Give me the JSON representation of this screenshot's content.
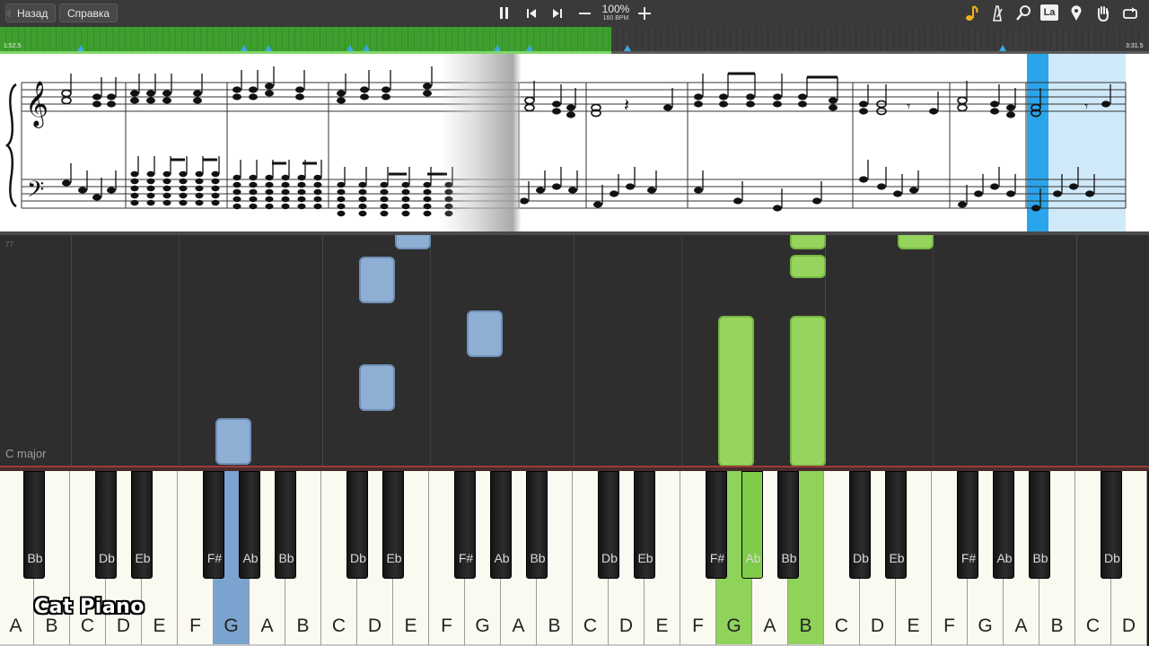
{
  "toolbar": {
    "back_label": "Назад",
    "help_label": "Справка",
    "zoom": "100%",
    "bpm": "160 BPM",
    "icons": [
      "pause-icon",
      "prev-icon",
      "next-icon",
      "minus-icon",
      "plus-icon",
      "note-icon",
      "metronome-icon",
      "search-icon",
      "la-icon",
      "pin-icon",
      "hand-icon",
      "loop-icon"
    ],
    "la_label": "La"
  },
  "timeline": {
    "start_time": "1:52.5",
    "end_time": "3:31.5",
    "progress": 0.53
  },
  "roll": {
    "measure_number": "77",
    "key_label": "C major"
  },
  "keyboard": {
    "white_keys": [
      "A",
      "B",
      "C",
      "D",
      "E",
      "F",
      "G",
      "A",
      "B",
      "C",
      "D",
      "E",
      "F",
      "G",
      "A",
      "B",
      "C",
      "D",
      "E",
      "F",
      "G",
      "A",
      "B",
      "C",
      "D",
      "E",
      "F",
      "G",
      "A",
      "B",
      "C",
      "D"
    ],
    "black_keys": [
      "Bb",
      "Db",
      "Eb",
      "F#",
      "Ab",
      "Bb",
      "Db",
      "Eb",
      "F#",
      "Ab",
      "Bb",
      "Db",
      "Eb",
      "F#",
      "Ab",
      "Bb",
      "Db",
      "Eb",
      "F#",
      "Ab",
      "Bb",
      "Db",
      "Eb"
    ],
    "active_blue": [
      "G"
    ],
    "active_green": [
      "G",
      "B"
    ],
    "colors": {
      "left_hand": "#7ba3cf",
      "right_hand": "#8fd35a"
    }
  },
  "watermark": "Cat Piano"
}
